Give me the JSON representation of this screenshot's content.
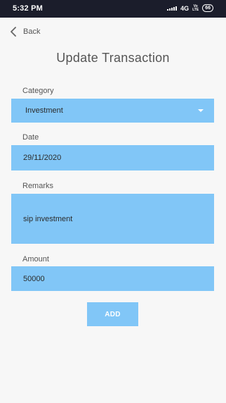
{
  "status_bar": {
    "time": "5:32 PM",
    "network": "4G",
    "volte_top": "Vo",
    "volte_bottom": "LTE",
    "battery": "66"
  },
  "nav": {
    "back_label": "Back"
  },
  "header": {
    "title": "Update Transaction"
  },
  "form": {
    "category": {
      "label": "Category",
      "value": "Investment"
    },
    "date": {
      "label": "Date",
      "value": "29/11/2020"
    },
    "remarks": {
      "label": "Remarks",
      "value": "sip investment"
    },
    "amount": {
      "label": "Amount",
      "value": "50000"
    },
    "submit_label": "ADD"
  },
  "colors": {
    "field_background": "#81c6f7",
    "status_bar": "#1b1d2b",
    "page_background": "#f7f7f7"
  }
}
